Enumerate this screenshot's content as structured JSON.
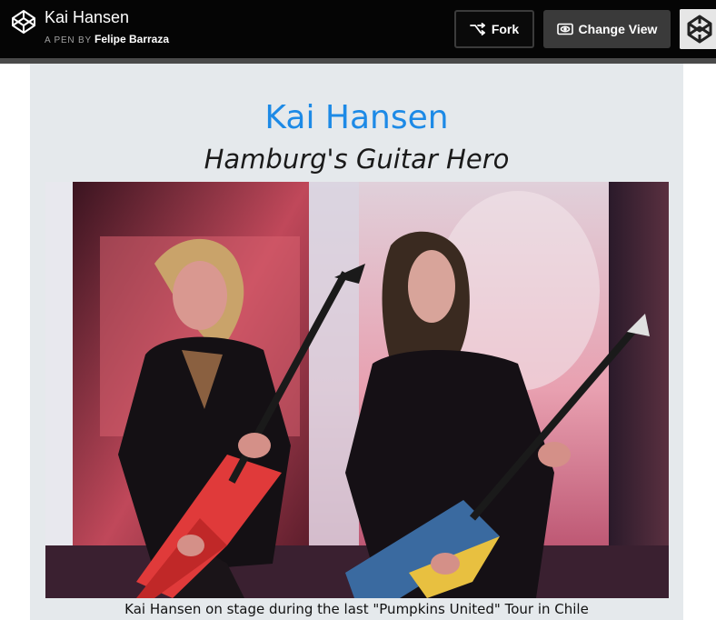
{
  "header": {
    "pen_title": "Kai Hansen",
    "pen_by_prefix": "A PEN BY",
    "author": "Felipe Barraza",
    "fork_label": "Fork",
    "change_view_label": "Change View",
    "logo_icon": "codepen-logo-icon",
    "fork_icon": "fork-icon",
    "change_view_icon": "eye-icon"
  },
  "main": {
    "title": "Kai Hansen",
    "subtitle": "Hamburg's Guitar Hero",
    "image_caption": "Kai Hansen on stage during the last \"Pumpkins United\" Tour in Chile"
  },
  "colors": {
    "title": "#1d8ae6",
    "content_bg": "#e5e9ec",
    "topbar_bg": "#050505"
  }
}
